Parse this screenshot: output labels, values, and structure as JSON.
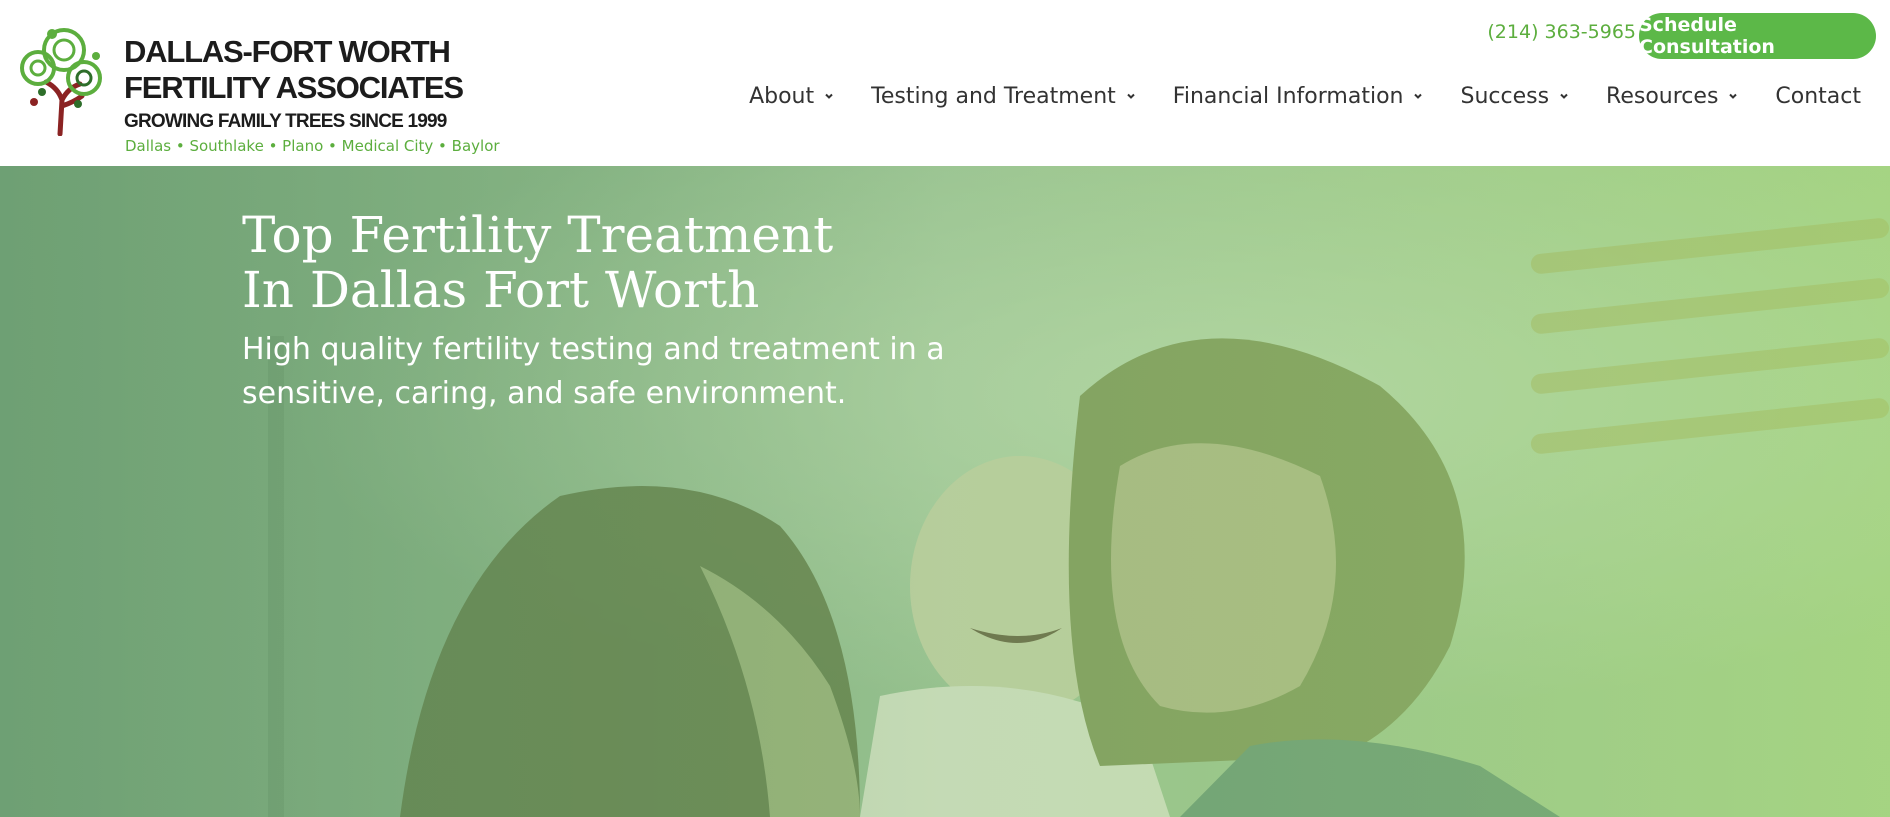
{
  "header": {
    "logo": {
      "title_line1": "DALLAS-FORT WORTH",
      "title_line2": "FERTILITY ASSOCIATES",
      "tagline": "GROWING FAMILY TREES SINCE 1999",
      "locations": "Dallas • Southlake • Plano • Medical City • Baylor",
      "icon": "tree-logo-icon"
    },
    "phone": "(214) 363-5965",
    "cta_label": "Schedule Consultation",
    "nav": [
      {
        "label": "About",
        "has_dropdown": true
      },
      {
        "label": "Testing and Treatment",
        "has_dropdown": true
      },
      {
        "label": "Financial Information",
        "has_dropdown": true
      },
      {
        "label": "Success",
        "has_dropdown": true
      },
      {
        "label": "Resources",
        "has_dropdown": true
      },
      {
        "label": "Contact",
        "has_dropdown": false
      }
    ]
  },
  "hero": {
    "title_line1": "Top Fertility Treatment",
    "title_line2": "In Dallas Fort Worth",
    "subtitle_before": "High quality ",
    "subtitle_link": "fertility testing and treatment",
    "subtitle_after": " in a sensitive, caring, and safe environment.",
    "background": "family-photo"
  },
  "colors": {
    "brand_green": "#5cb848",
    "text_dark": "#333333",
    "logo_trunk": "#8b2323"
  }
}
